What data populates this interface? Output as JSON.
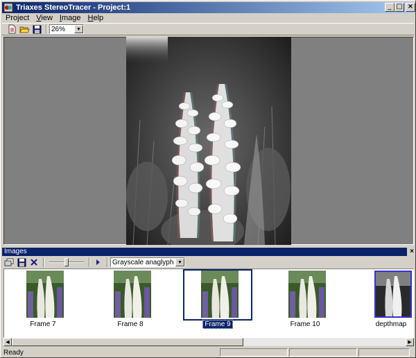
{
  "window": {
    "title": "Triaxes StereoTracer - Project:1"
  },
  "title_controls": {
    "minimize": "_",
    "maximize": "□",
    "close": "×"
  },
  "menu": [
    {
      "label": "Project",
      "accel": "j",
      "pre": "Pro",
      "post": "ect"
    },
    {
      "label": "View",
      "accel": "V",
      "pre": "",
      "post": "iew"
    },
    {
      "label": "Image",
      "accel": "I",
      "pre": "",
      "post": "mage"
    },
    {
      "label": "Help",
      "accel": "H",
      "pre": "",
      "post": "elp"
    }
  ],
  "toolbar": {
    "new_icon": "new-document-icon",
    "open_icon": "open-folder-icon",
    "save_icon": "save-disk-icon",
    "zoom": {
      "value": "26%"
    }
  },
  "images_panel": {
    "title": "Images",
    "close": "×",
    "mode": {
      "value": "Grayscale anaglyph"
    },
    "slider_fraction": 0.5,
    "frames": [
      {
        "caption": "Frame 7"
      },
      {
        "caption": "Frame 8"
      },
      {
        "caption": "Frame 9",
        "selected": true
      },
      {
        "caption": "Frame 10"
      },
      {
        "caption": "depthmap"
      }
    ]
  },
  "status": {
    "text": "Ready"
  },
  "colors": {
    "title_start": "#0a246a",
    "title_end": "#a6caf0",
    "canvas": "#808080",
    "selection": "#0a246a"
  }
}
